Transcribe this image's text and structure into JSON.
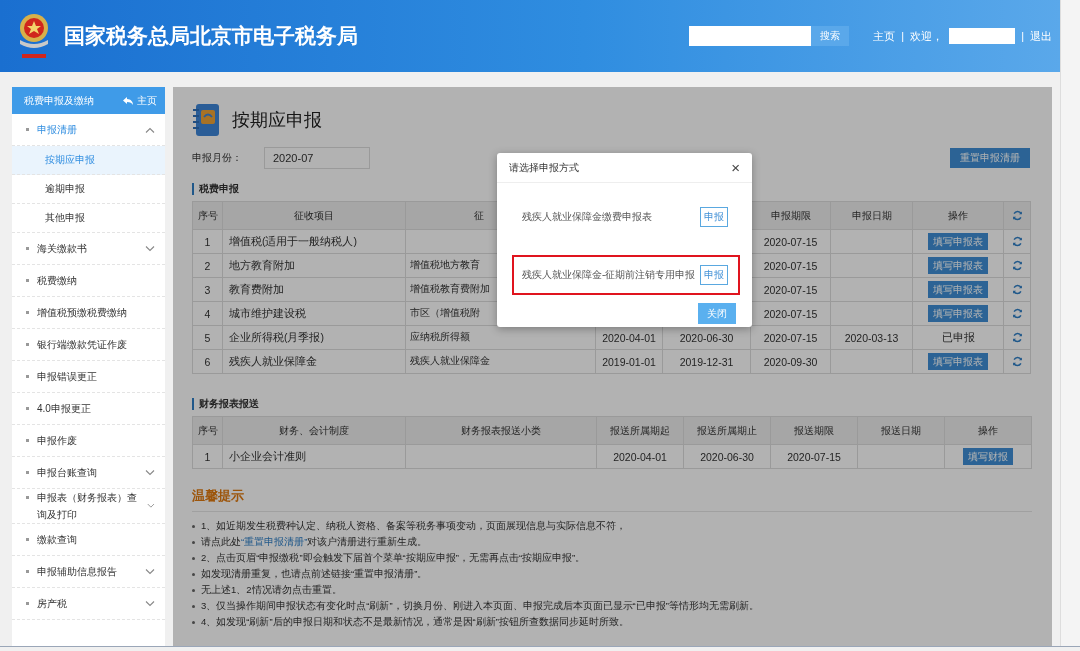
{
  "header": {
    "title": "国家税务总局北京市电子税务局",
    "search_button": "搜索",
    "links": [
      "主页",
      "|",
      "欢迎，"
    ],
    "logout_separator": "|",
    "logout": "退出"
  },
  "sidebar": {
    "title": "税费申报及缴纳",
    "home": "主页",
    "items": [
      {
        "label": "申报清册",
        "kind": "folder",
        "expanded": true,
        "children": [
          {
            "label": "按期应申报",
            "selected": true
          },
          {
            "label": "逾期申报",
            "selected": false
          },
          {
            "label": "其他申报",
            "selected": false
          }
        ]
      },
      {
        "label": "海关缴款书",
        "kind": "folder",
        "expanded": false
      },
      {
        "label": "税费缴纳",
        "kind": "link"
      },
      {
        "label": "增值税预缴税费缴纳",
        "kind": "link"
      },
      {
        "label": "银行端缴款凭证作废",
        "kind": "link"
      },
      {
        "label": "申报错误更正",
        "kind": "link"
      },
      {
        "label": "4.0申报更正",
        "kind": "link"
      },
      {
        "label": "申报作废",
        "kind": "link"
      },
      {
        "label": "申报台账查询",
        "kind": "folder",
        "expanded": false
      },
      {
        "label": "申报表（财务报表）查询及打印",
        "kind": "folder",
        "expanded": false
      },
      {
        "label": "缴款查询",
        "kind": "link"
      },
      {
        "label": "申报辅助信息报告",
        "kind": "folder",
        "expanded": false
      },
      {
        "label": "房产税",
        "kind": "folder",
        "expanded": false
      }
    ]
  },
  "page": {
    "title": "按期应申报",
    "month_label": "申报月份：",
    "month_value": "2020-07",
    "reset_button": "重置申报清册"
  },
  "tax_section": {
    "title": "税费申报",
    "columns": [
      "序号",
      "征收项目",
      "征",
      null,
      null,
      "申报期限",
      "申报日期",
      "操作"
    ],
    "rows": [
      {
        "cells": [
          "1",
          "增值税(适用于一般纳税人)",
          null,
          null,
          null,
          "2020-07-15",
          null
        ],
        "action": {
          "kind": "button",
          "label": "填写申报表"
        }
      },
      {
        "cells": [
          "2",
          "地方教育附加",
          "增值税地方教育",
          null,
          null,
          "2020-07-15",
          null
        ],
        "action": {
          "kind": "button",
          "label": "填写申报表"
        }
      },
      {
        "cells": [
          "3",
          "教育费附加",
          "增值税教育费附加",
          null,
          null,
          "2020-07-15",
          null
        ],
        "action": {
          "kind": "button",
          "label": "填写申报表"
        }
      },
      {
        "cells": [
          "4",
          "城市维护建设税",
          "市区（增值税附",
          null,
          null,
          "2020-07-15",
          null
        ],
        "action": {
          "kind": "button",
          "label": "填写申报表"
        }
      },
      {
        "cells": [
          "5",
          "企业所得税(月季报)",
          "应纳税所得额",
          "2020-04-01",
          "2020-06-30",
          "2020-07-15",
          "2020-03-13"
        ],
        "action": {
          "kind": "text",
          "label": "已申报"
        }
      },
      {
        "cells": [
          "6",
          "残疾人就业保障金",
          "残疾人就业保障金",
          "2019-01-01",
          "2019-12-31",
          "2020-09-30",
          null
        ],
        "action": {
          "kind": "button",
          "label": "填写申报表"
        }
      }
    ]
  },
  "report_section": {
    "title": "财务报表报送",
    "columns": [
      "序号",
      "财务、会计制度",
      "财务报表报送小类",
      "报送所属期起",
      "报送所属期止",
      "报送期限",
      "报送日期",
      "操作"
    ],
    "rows": [
      {
        "cells": [
          "1",
          "小企业会计准则",
          null,
          "2020-04-01",
          "2020-06-30",
          "2020-07-15",
          null
        ],
        "action": {
          "kind": "button",
          "label": "填写财报"
        }
      }
    ]
  },
  "tips": {
    "title": "温馨提示",
    "lines": [
      {
        "text": "1、如近期发生税费种认定、纳税人资格、备案等税务事项变动，页面展现信息与实际信息不符，"
      },
      {
        "text": "请点此处",
        "link": "“重置申报清册”",
        "after": "对该户清册进行重新生成。"
      },
      {
        "text": "2、点击页眉“申报缴税”即会触发下届首个菜单“按期应申报”，无需再点击“按期应申报”。"
      },
      {
        "text": "如发现清册重复，也请点前述链接“重置申报清册”。"
      },
      {
        "text": "无上述1、2情况请勿点击重置。"
      },
      {
        "text": "3、仅当操作期间申报状态有变化时点“刷新”，切换月份、刚进入本页面、申报完成后本页面已显示“已申报”等情形均无需刷新。"
      },
      {
        "text": "4、如发现“刷新”后的申报日期和状态不是最新情况，通常是因“刷新”按钮所查数据同步延时所致。"
      }
    ]
  },
  "dialog": {
    "title": "请选择申报方式",
    "close_icon": "×",
    "options": [
      {
        "label": "残疾人就业保障金缴费申报表",
        "button": "申报",
        "highlighted": false
      },
      {
        "label": "残疾人就业保障金-征期前注销专用申报",
        "button": "申报",
        "highlighted": true
      }
    ],
    "close_button": "关闭"
  }
}
